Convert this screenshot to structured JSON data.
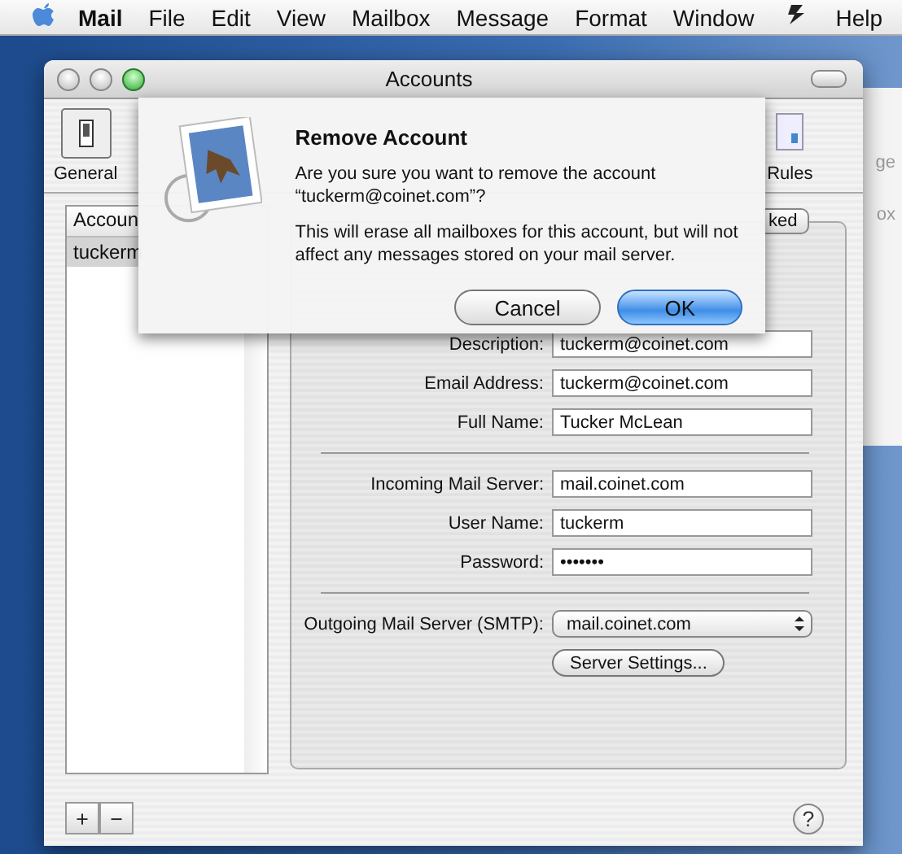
{
  "menu_bar": {
    "items": [
      {
        "label": "Mail",
        "kind": "app"
      },
      {
        "label": "File",
        "kind": "menu"
      },
      {
        "label": "Edit",
        "kind": "menu"
      },
      {
        "label": "View",
        "kind": "menu"
      },
      {
        "label": "Mailbox",
        "kind": "menu"
      },
      {
        "label": "Message",
        "kind": "menu"
      },
      {
        "label": "Format",
        "kind": "menu"
      },
      {
        "label": "Window",
        "kind": "menu"
      },
      {
        "label": "Help",
        "kind": "menu"
      }
    ]
  },
  "background_window": {
    "texts": [
      "ge",
      "ox"
    ]
  },
  "window": {
    "title": "Accounts",
    "toolbar": [
      {
        "label": "General",
        "selected": false
      },
      {
        "label": "Rules",
        "selected": false
      }
    ],
    "accounts_list": {
      "header": "Accoun",
      "rows": [
        {
          "label": "tuckerm",
          "selected": true
        }
      ]
    },
    "tabs": [
      {
        "label": "ked",
        "selected": false
      }
    ],
    "sections": [
      {
        "fields": [
          {
            "label": "Description:",
            "value": "tuckerm@coinet.com",
            "kind": "text"
          },
          {
            "label": "Email Address:",
            "value": "tuckerm@coinet.com",
            "kind": "text"
          },
          {
            "label": "Full Name:",
            "value": "Tucker McLean",
            "kind": "text"
          }
        ]
      },
      {
        "fields": [
          {
            "label": "Incoming Mail Server:",
            "value": "mail.coinet.com",
            "kind": "text"
          },
          {
            "label": "User Name:",
            "value": "tuckerm",
            "kind": "text"
          },
          {
            "label": "Password:",
            "value": "•••••••",
            "kind": "text"
          }
        ]
      },
      {
        "fields": [
          {
            "label": "Outgoing Mail Server (SMTP):",
            "value": "mail.coinet.com",
            "kind": "popup"
          }
        ]
      }
    ],
    "server_settings_button": "Server Settings...",
    "list_buttons": [
      "+",
      "−"
    ],
    "help_button": "?"
  },
  "sheet": {
    "title": "Remove Account",
    "message": "Are you sure you want to remove the account “tuckerm@coinet.com”?",
    "detail": "This will erase all mailboxes for this account, but will not affect any messages stored on your mail server.",
    "buttons": [
      {
        "label": "Cancel",
        "kind": "normal"
      },
      {
        "label": "OK",
        "kind": "default"
      }
    ]
  }
}
